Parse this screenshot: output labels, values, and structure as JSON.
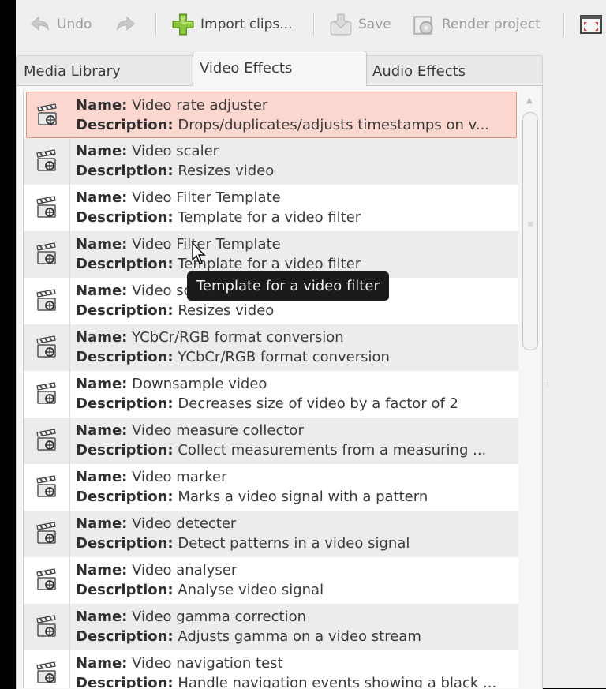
{
  "toolbar": {
    "undo_label": "Undo",
    "import_label": "Import clips...",
    "save_label": "Save",
    "render_label": "Render project"
  },
  "tabs": [
    {
      "label": "Media Library"
    },
    {
      "label": "Video Effects"
    },
    {
      "label": "Audio Effects"
    }
  ],
  "effects": {
    "name_key": "Name:",
    "desc_key": "Description:",
    "items": [
      {
        "name": "Video rate adjuster",
        "description": "Drops/duplicates/adjusts timestamps on v..."
      },
      {
        "name": "Video scaler",
        "description": "Resizes video"
      },
      {
        "name": "Video Filter Template",
        "description": "Template for a video filter"
      },
      {
        "name": "Video Filter Template",
        "description": "Template for a video filter"
      },
      {
        "name": "Video scaler",
        "description": "Resizes video"
      },
      {
        "name": "YCbCr/RGB format conversion",
        "description": "YCbCr/RGB format conversion"
      },
      {
        "name": "Downsample video",
        "description": "Decreases size of video by a factor of 2"
      },
      {
        "name": "Video measure collector",
        "description": "Collect measurements from a measuring ..."
      },
      {
        "name": "Video marker",
        "description": "Marks a video signal with a pattern"
      },
      {
        "name": "Video detecter",
        "description": "Detect patterns in a video signal"
      },
      {
        "name": "Video analyser",
        "description": "Analyse video signal"
      },
      {
        "name": "Video gamma correction",
        "description": "Adjusts gamma on a video stream"
      },
      {
        "name": "Video navigation test",
        "description": "Handle navigation events showing a black ..."
      }
    ]
  },
  "tooltip": {
    "text": "Template for a video filter"
  },
  "colors": {
    "selected_row_bg": "#fbd7d0",
    "selected_row_border": "#e89080",
    "tooltip_bg": "#1b1b1b"
  }
}
